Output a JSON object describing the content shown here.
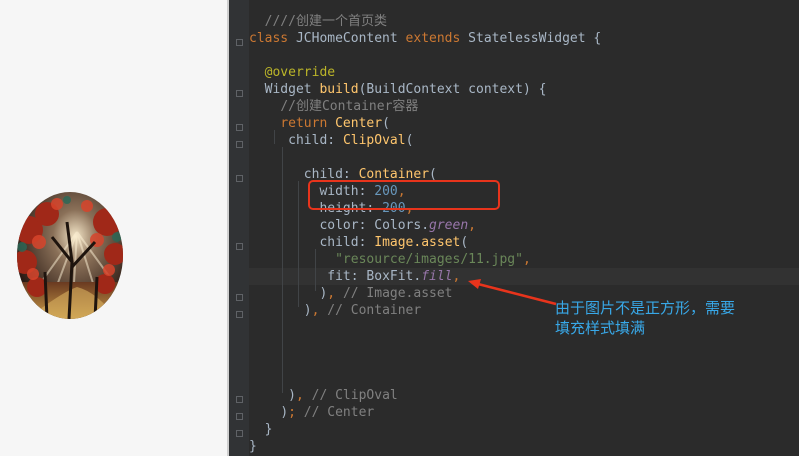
{
  "colors": {
    "editor_bg": "#2b2b2b",
    "keyword": "#cc7832",
    "function": "#ffc66d",
    "comment": "#808080",
    "number": "#6897bb",
    "string": "#6a8759",
    "annotation_red": "#e8341c",
    "annotation_blue": "#38a8e8"
  },
  "preview": {
    "image_icon": "forest-image"
  },
  "code": [
    {
      "t": "cm",
      "v": "////创建一个首页类"
    },
    {
      "t": "kw",
      "v": "class "
    },
    {
      "t": "plain",
      "v": "JCHomeContent "
    },
    {
      "t": "kw",
      "v": "extends "
    },
    {
      "t": "plain",
      "v": "StatelessWidget {"
    },
    {
      "t": "anno",
      "v": "@override"
    },
    {
      "t": "plain",
      "v": "Widget "
    },
    {
      "t": "fn",
      "v": "build"
    },
    {
      "t": "plain",
      "v": "(BuildContext context) {"
    },
    {
      "t": "cm",
      "v": "//创建Container容器"
    },
    {
      "t": "kw",
      "v": "return "
    },
    {
      "t": "fn",
      "v": "Center"
    },
    {
      "t": "plain",
      "v": "("
    },
    {
      "t": "plain",
      "v": "child: "
    },
    {
      "t": "fn",
      "v": "ClipOval"
    },
    {
      "t": "plain",
      "v": "("
    },
    {
      "t": "plain",
      "v": "child: "
    },
    {
      "t": "fn",
      "v": "Container"
    },
    {
      "t": "plain",
      "v": "("
    },
    {
      "t": "plain",
      "v": "width: "
    },
    {
      "t": "num",
      "v": "200"
    },
    {
      "t": "kw",
      "v": ","
    },
    {
      "t": "plain",
      "v": "height: "
    },
    {
      "t": "num",
      "v": "200"
    },
    {
      "t": "kw",
      "v": ","
    },
    {
      "t": "plain",
      "v": "color: Colors."
    },
    {
      "t": "fld",
      "v": "green"
    },
    {
      "t": "kw",
      "v": ","
    },
    {
      "t": "plain",
      "v": "child: "
    },
    {
      "t": "fn",
      "v": "Image.asset"
    },
    {
      "t": "plain",
      "v": "("
    },
    {
      "t": "str",
      "v": "\"resource/images/11.jpg\""
    },
    {
      "t": "kw",
      "v": ","
    },
    {
      "t": "plain",
      "v": "fit: BoxFit."
    },
    {
      "t": "fld",
      "v": "fill"
    },
    {
      "t": "kw",
      "v": ","
    },
    {
      "t": "plain",
      "v": ")"
    },
    {
      "t": "kw",
      "v": ", "
    },
    {
      "t": "cm",
      "v": "// Image.asset"
    },
    {
      "t": "plain",
      "v": ")"
    },
    {
      "t": "kw",
      "v": ", "
    },
    {
      "t": "cm",
      "v": "// Container"
    },
    {
      "t": "plain",
      "v": ")"
    },
    {
      "t": "kw",
      "v": ", "
    },
    {
      "t": "cm",
      "v": "// ClipOval"
    },
    {
      "t": "plain",
      "v": ")"
    },
    {
      "t": "kw",
      "v": "; "
    },
    {
      "t": "cm",
      "v": "// Center"
    },
    {
      "t": "plain",
      "v": "}"
    },
    {
      "t": "plain",
      "v": "}"
    }
  ],
  "annotation_text": "由于图片不是正方形，需要\n填充样式填满"
}
